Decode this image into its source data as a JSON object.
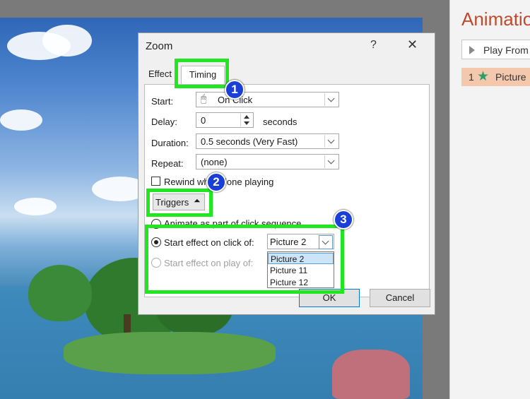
{
  "dialog": {
    "title": "Zoom",
    "help": "?",
    "close": "✕",
    "tabs": [
      {
        "label": "Effect"
      },
      {
        "label": "Timing"
      }
    ],
    "start_label": "Start:",
    "start_value": "On Click",
    "delay_label": "Delay:",
    "delay_value": "0",
    "delay_unit": "seconds",
    "duration_label": "Duration:",
    "duration_value": "0.5 seconds (Very Fast)",
    "repeat_label": "Repeat:",
    "repeat_value": "(none)",
    "rewind_label": "Rewind when done playing",
    "triggers_label": "Triggers",
    "animate_label": "Animate as part of click sequence",
    "click_label": "Start effect on click of:",
    "click_value": "Picture 2",
    "play_label": "Start effect on play of:",
    "ok": "OK",
    "cancel": "Cancel",
    "dropdown_options": [
      "Picture 2",
      "Picture 11",
      "Picture 12"
    ]
  },
  "side_panel": {
    "title": "Animatio",
    "play_from": "Play From",
    "item_number": "1",
    "item_label": "Picture"
  },
  "badges": [
    "1",
    "2",
    "3"
  ],
  "colors": {
    "highlight": "#22e622",
    "badge": "#1a3fd6",
    "title_accent": "#c04a2d"
  }
}
